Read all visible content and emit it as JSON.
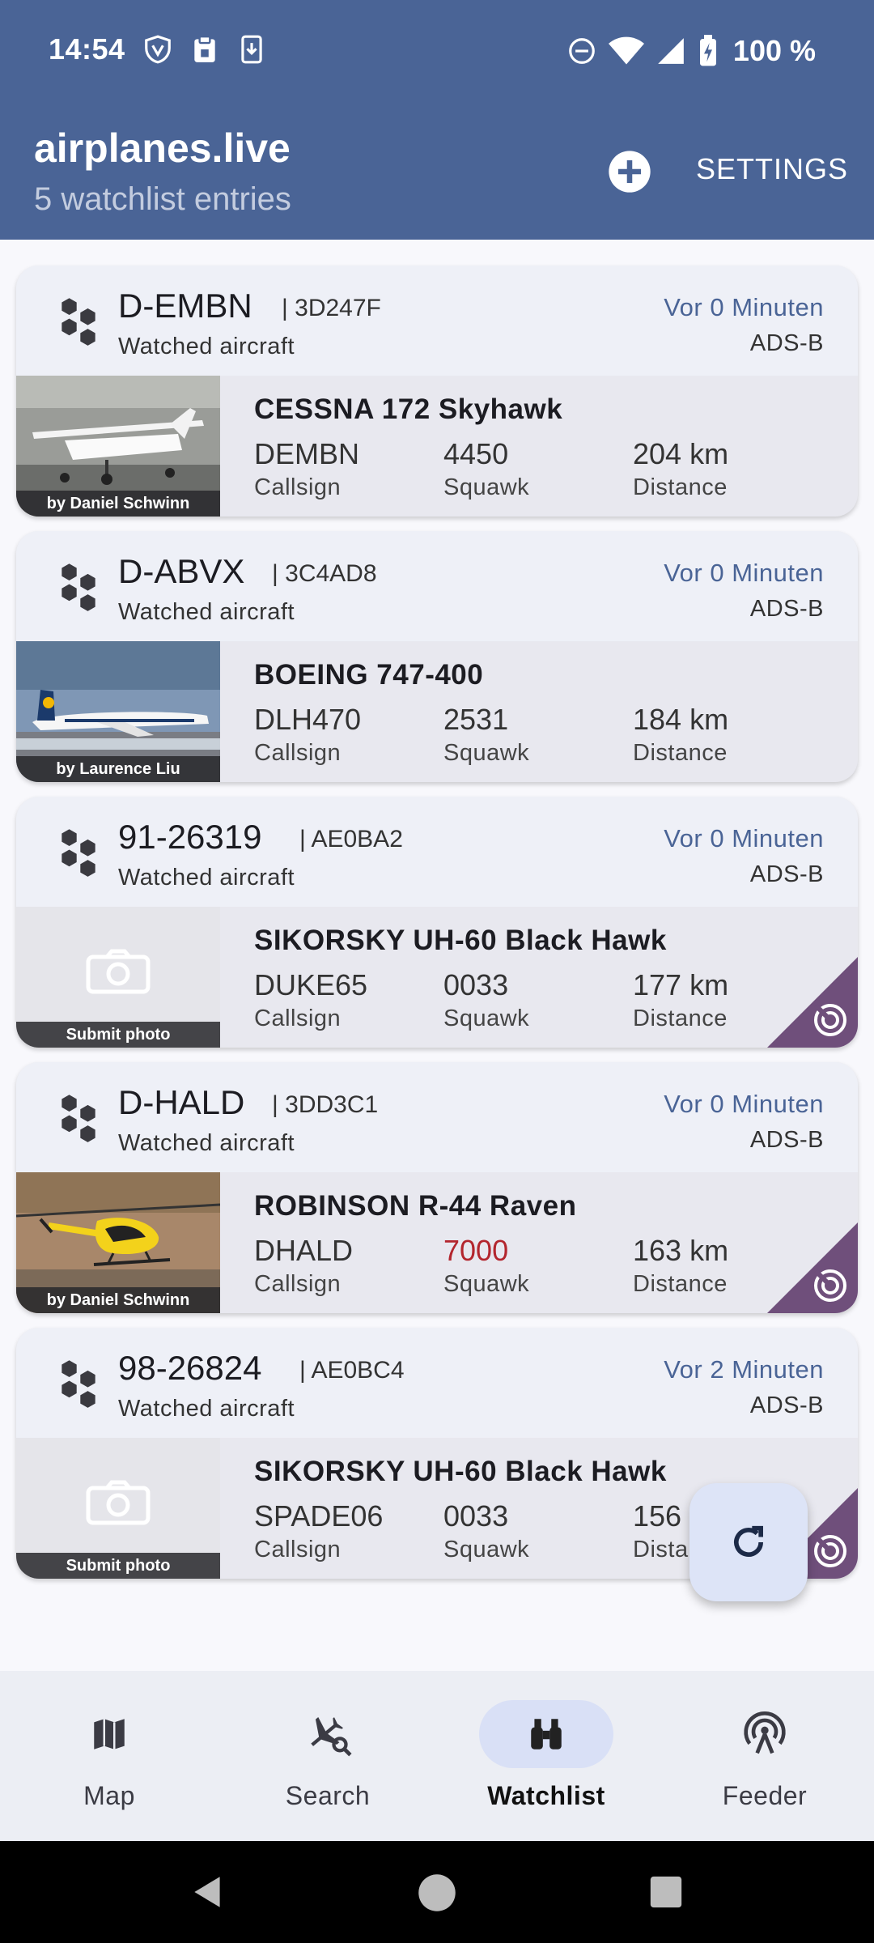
{
  "status_bar": {
    "time": "14:54",
    "left_icons": [
      "shield-v-icon",
      "clipboard-icon",
      "download-icon"
    ],
    "right_icons": [
      "dnd-icon",
      "wifi-icon",
      "signal-icon",
      "battery-charging-icon"
    ],
    "battery": "100 %"
  },
  "header": {
    "title": "airplanes.live",
    "subtitle": "5 watchlist entries",
    "add_icon": "add-circle-icon",
    "settings_label": "SETTINGS"
  },
  "labels": {
    "callsign": "Callsign",
    "squawk": "Squawk",
    "distance": "Distance",
    "watched": "Watched aircraft"
  },
  "cards": [
    {
      "registration": "D-EMBN",
      "hex": "| 3D247F",
      "time_ago": "Vor 0 Minuten",
      "source": "ADS-B",
      "aircraft_type": "CESSNA 172 Skyhawk",
      "callsign": "DEMBN",
      "squawk": "4450",
      "distance": "204 km",
      "photo_caption": "by Daniel Schwinn",
      "has_photo": true,
      "feeder_badge": false
    },
    {
      "registration": "D-ABVX",
      "hex": "| 3C4AD8",
      "time_ago": "Vor 0 Minuten",
      "source": "ADS-B",
      "aircraft_type": "BOEING 747-400",
      "callsign": "DLH470",
      "squawk": "2531",
      "distance": "184 km",
      "photo_caption": "by Laurence Liu",
      "has_photo": true,
      "feeder_badge": false
    },
    {
      "registration": "91-26319",
      "hex": "| AE0BA2",
      "time_ago": "Vor 0 Minuten",
      "source": "ADS-B",
      "aircraft_type": "SIKORSKY UH-60 Black Hawk",
      "callsign": "DUKE65",
      "squawk": "0033",
      "distance": "177 km",
      "photo_caption": "Submit photo",
      "has_photo": false,
      "feeder_badge": true
    },
    {
      "registration": "D-HALD",
      "hex": "| 3DD3C1",
      "time_ago": "Vor 0 Minuten",
      "source": "ADS-B",
      "aircraft_type": "ROBINSON R-44 Raven",
      "callsign": "DHALD",
      "squawk": "7000",
      "distance": "163 km",
      "photo_caption": "by Daniel Schwinn",
      "has_photo": true,
      "feeder_badge": true,
      "squawk_color": "#b3262e"
    },
    {
      "registration": "98-26824",
      "hex": "| AE0BC4",
      "time_ago": "Vor 2 Minuten",
      "source": "ADS-B",
      "aircraft_type": "SIKORSKY UH-60 Black Hawk",
      "callsign": "SPADE06",
      "squawk": "0033",
      "distance": "156",
      "distance_label": "Dista",
      "photo_caption": "Submit photo",
      "has_photo": false,
      "feeder_badge": true
    }
  ],
  "fab": {
    "icon": "refresh-icon"
  },
  "bottom_nav": [
    {
      "label": "Map",
      "icon": "map-icon",
      "active": false
    },
    {
      "label": "Search",
      "icon": "flight-search-icon",
      "active": false
    },
    {
      "label": "Watchlist",
      "icon": "binoculars-icon",
      "active": true
    },
    {
      "label": "Feeder",
      "icon": "antenna-icon",
      "active": false
    }
  ],
  "system_nav": [
    "back-icon",
    "home-icon",
    "recents-icon"
  ],
  "colors": {
    "header_bg": "#4a6496",
    "accent_text": "#4a6496",
    "feeder_badge": "#6f4f7b",
    "squawk_alert": "#b3262e"
  }
}
